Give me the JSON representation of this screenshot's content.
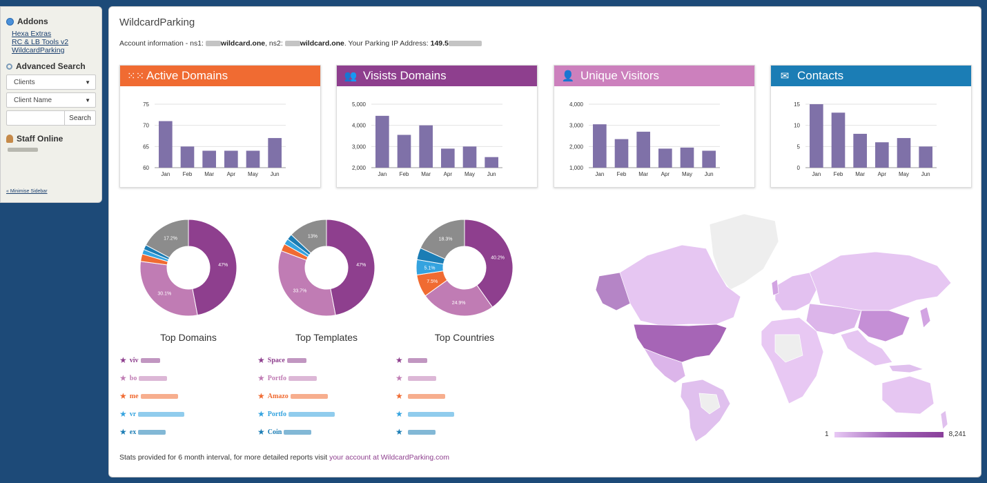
{
  "sidebar": {
    "addons_title": "Addons",
    "addon_links": [
      "Hexa Extras",
      "RC & LB Tools v2",
      "WildcardParking"
    ],
    "advanced_search_title": "Advanced Search",
    "select_type": "Clients",
    "select_field": "Client Name",
    "search_button": "Search",
    "staff_title": "Staff Online",
    "minimise": "« Minimise Sidebar"
  },
  "page": {
    "title": "WildcardParking",
    "account_prefix": "Account information - ns1:",
    "ns1_domain": "wildcard.one",
    "ns2_label": ", ns2:",
    "ns2_domain": "wildcard.one",
    "ip_label": ". Your Parking IP Address:",
    "ip_value": "149.5",
    "footer_text": "Stats provided for 6 month interval, for more detailed reports visit ",
    "footer_link": "your account at WildcardParking.com"
  },
  "cards": [
    {
      "title": "Active Domains",
      "icon": "grid-icon",
      "color": "#f06b32"
    },
    {
      "title": "Visists Domains",
      "icon": "users-icon",
      "color": "#8e3f8e"
    },
    {
      "title": "Unique Visitors",
      "icon": "user-icon",
      "color": "#cc80bd"
    },
    {
      "title": "Contacts",
      "icon": "envelope-icon",
      "color": "#1b7db5"
    }
  ],
  "chart_data": [
    {
      "type": "bar",
      "title": "Active Domains",
      "categories": [
        "Jan",
        "Feb",
        "Mar",
        "Apr",
        "May",
        "Jun"
      ],
      "values": [
        71,
        65,
        64,
        64,
        64,
        67
      ],
      "ylim": [
        60,
        75
      ],
      "yticks": [
        "60",
        "65",
        "70",
        "75"
      ],
      "tick_values": [
        60,
        65,
        70,
        75
      ],
      "grid": true,
      "color": "#7f71a8"
    },
    {
      "type": "bar",
      "title": "Visists Domains",
      "categories": [
        "Jan",
        "Feb",
        "Mar",
        "Apr",
        "May",
        "Jun"
      ],
      "values": [
        4450,
        3550,
        4000,
        2900,
        3000,
        2500
      ],
      "ylim": [
        2000,
        5000
      ],
      "yticks": [
        "2,000",
        "3,000",
        "4,000",
        "5,000"
      ],
      "tick_values": [
        2000,
        3000,
        4000,
        5000
      ],
      "grid": true,
      "color": "#7f71a8"
    },
    {
      "type": "bar",
      "title": "Unique Visitors",
      "categories": [
        "Jan",
        "Feb",
        "Mar",
        "Apr",
        "May",
        "Jun"
      ],
      "values": [
        3050,
        2350,
        2700,
        1900,
        1950,
        1800
      ],
      "ylim": [
        1000,
        4000
      ],
      "yticks": [
        "1,000",
        "2,000",
        "3,000",
        "4,000"
      ],
      "tick_values": [
        1000,
        2000,
        3000,
        4000
      ],
      "grid": true,
      "color": "#7f71a8"
    },
    {
      "type": "bar",
      "title": "Contacts",
      "categories": [
        "Jan",
        "Feb",
        "Mar",
        "Apr",
        "May",
        "Jun"
      ],
      "values": [
        15,
        13,
        8,
        6,
        7,
        5
      ],
      "ylim": [
        0,
        15
      ],
      "yticks": [
        "0",
        "5",
        "10",
        "15"
      ],
      "tick_values": [
        0,
        5,
        10,
        15
      ],
      "grid": true,
      "color": "#7f71a8"
    },
    {
      "type": "pie",
      "title": "Top Domains",
      "values": [
        47,
        30.1,
        2.5,
        1.6,
        1.6,
        17.2
      ],
      "labels": [
        "47%",
        "30.1%",
        "",
        "",
        "",
        "17.2%"
      ],
      "colors": [
        "#8e3f8e",
        "#c07cb4",
        "#f06b32",
        "#34a3df",
        "#1b7db5",
        "#8c8c8c"
      ]
    },
    {
      "type": "pie",
      "title": "Top Templates",
      "values": [
        47,
        33.7,
        2.5,
        1.9,
        1.9,
        13
      ],
      "labels": [
        "47%",
        "33.7%",
        "",
        "",
        "",
        "13%"
      ],
      "colors": [
        "#8e3f8e",
        "#c07cb4",
        "#f06b32",
        "#34a3df",
        "#1b7db5",
        "#8c8c8c"
      ]
    },
    {
      "type": "pie",
      "title": "Top Countries",
      "values": [
        40.2,
        24.9,
        7.5,
        5.1,
        4,
        18.3
      ],
      "labels": [
        "40.2%",
        "24.9%",
        "7.5%",
        "5.1%",
        "",
        "18.3%"
      ],
      "colors": [
        "#8e3f8e",
        "#c07cb4",
        "#f06b32",
        "#34a3df",
        "#1b7db5",
        "#8c8c8c"
      ]
    }
  ],
  "legends": {
    "domains": [
      {
        "text": "viv",
        "color": "#8e3f8e"
      },
      {
        "text": "bo",
        "color": "#c07cb4"
      },
      {
        "text": "me",
        "color": "#f06b32"
      },
      {
        "text": "vr",
        "color": "#34a3df"
      },
      {
        "text": "ex",
        "color": "#1b7db5"
      }
    ],
    "templates": [
      {
        "text": "Space",
        "color": "#8e3f8e"
      },
      {
        "text": "Portfo",
        "color": "#c07cb4"
      },
      {
        "text": "Amazo",
        "color": "#f06b32"
      },
      {
        "text": "Portfo",
        "color": "#34a3df"
      },
      {
        "text": "Coin",
        "color": "#1b7db5"
      }
    ],
    "countries": [
      {
        "text": "",
        "color": "#8e3f8e"
      },
      {
        "text": "",
        "color": "#c07cb4"
      },
      {
        "text": "",
        "color": "#f06b32"
      },
      {
        "text": "",
        "color": "#34a3df"
      },
      {
        "text": "",
        "color": "#1b7db5"
      }
    ]
  },
  "map": {
    "legend_min": "1",
    "legend_max": "8,241"
  }
}
